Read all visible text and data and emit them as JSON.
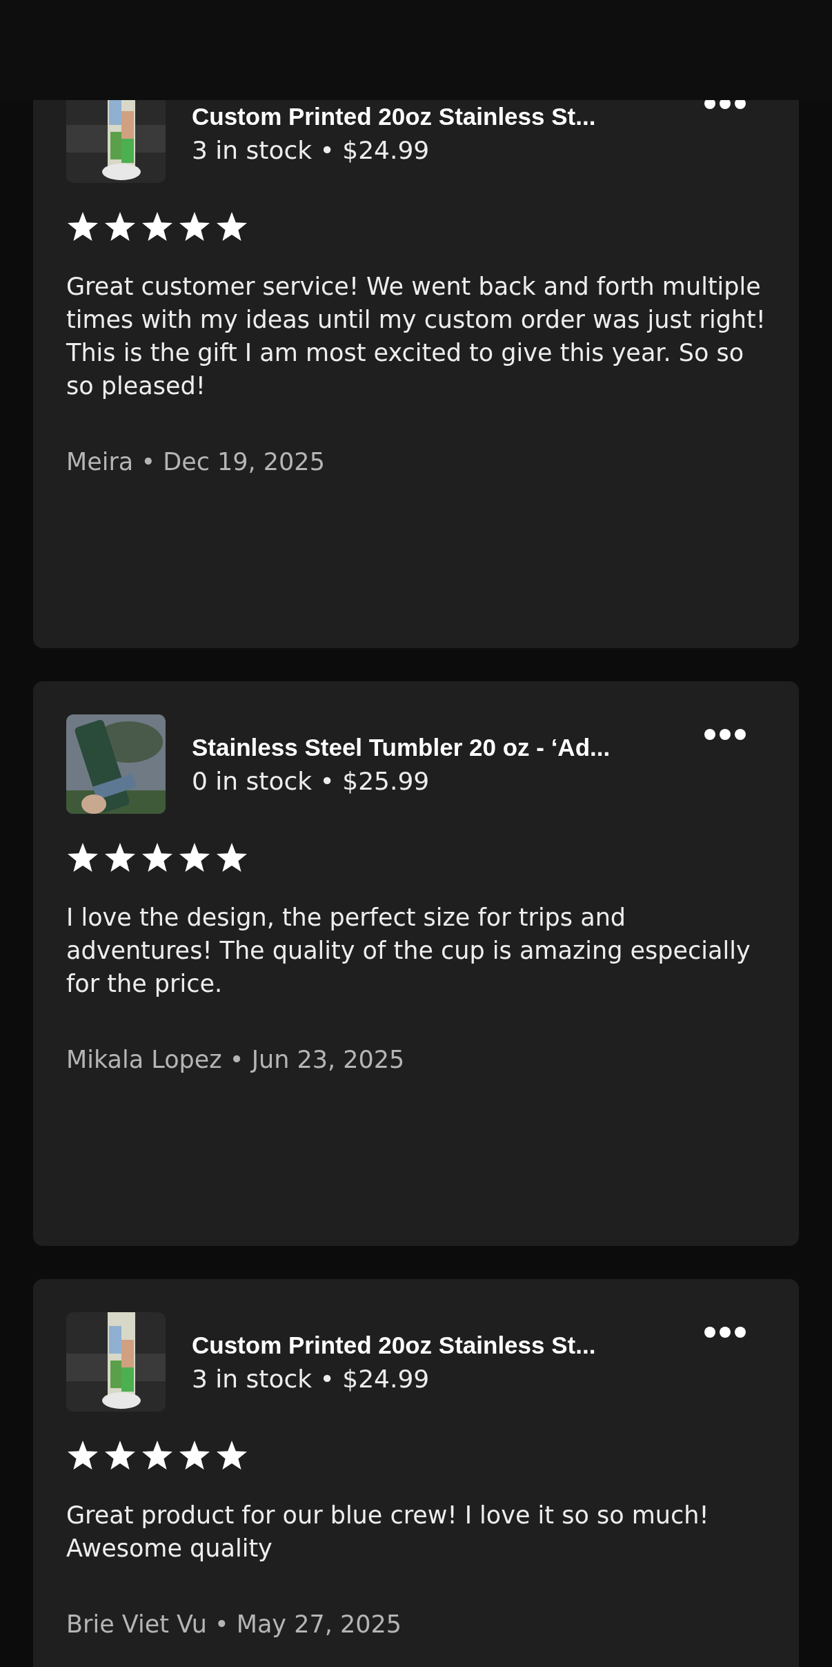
{
  "reviews": [
    {
      "product": {
        "title": "Custom Printed 20oz Stainless St...",
        "stock_price": "3 in stock • $24.99"
      },
      "stars": 5,
      "text": "Great customer service! We went back and forth multiple times with my ideas until my custom order was just right! This is the gift I am most excited to give this year. So so so pleased!",
      "byline": "Meira • Dec 19, 2025"
    },
    {
      "product": {
        "title": "Stainless Steel Tumbler 20 oz - ‘Ad...",
        "stock_price": "0 in stock • $25.99"
      },
      "stars": 5,
      "text": "I love the design, the perfect size for trips and adventures! The quality of the cup is amazing especially for the price.",
      "byline": "Mikala Lopez • Jun 23, 2025"
    },
    {
      "product": {
        "title": "Custom Printed 20oz Stainless St...",
        "stock_price": "3 in stock • $24.99"
      },
      "stars": 5,
      "text": "Great product for our blue crew! I love it so so much! Awesome quality",
      "byline": "Brie Viet Vu • May 27, 2025"
    }
  ]
}
